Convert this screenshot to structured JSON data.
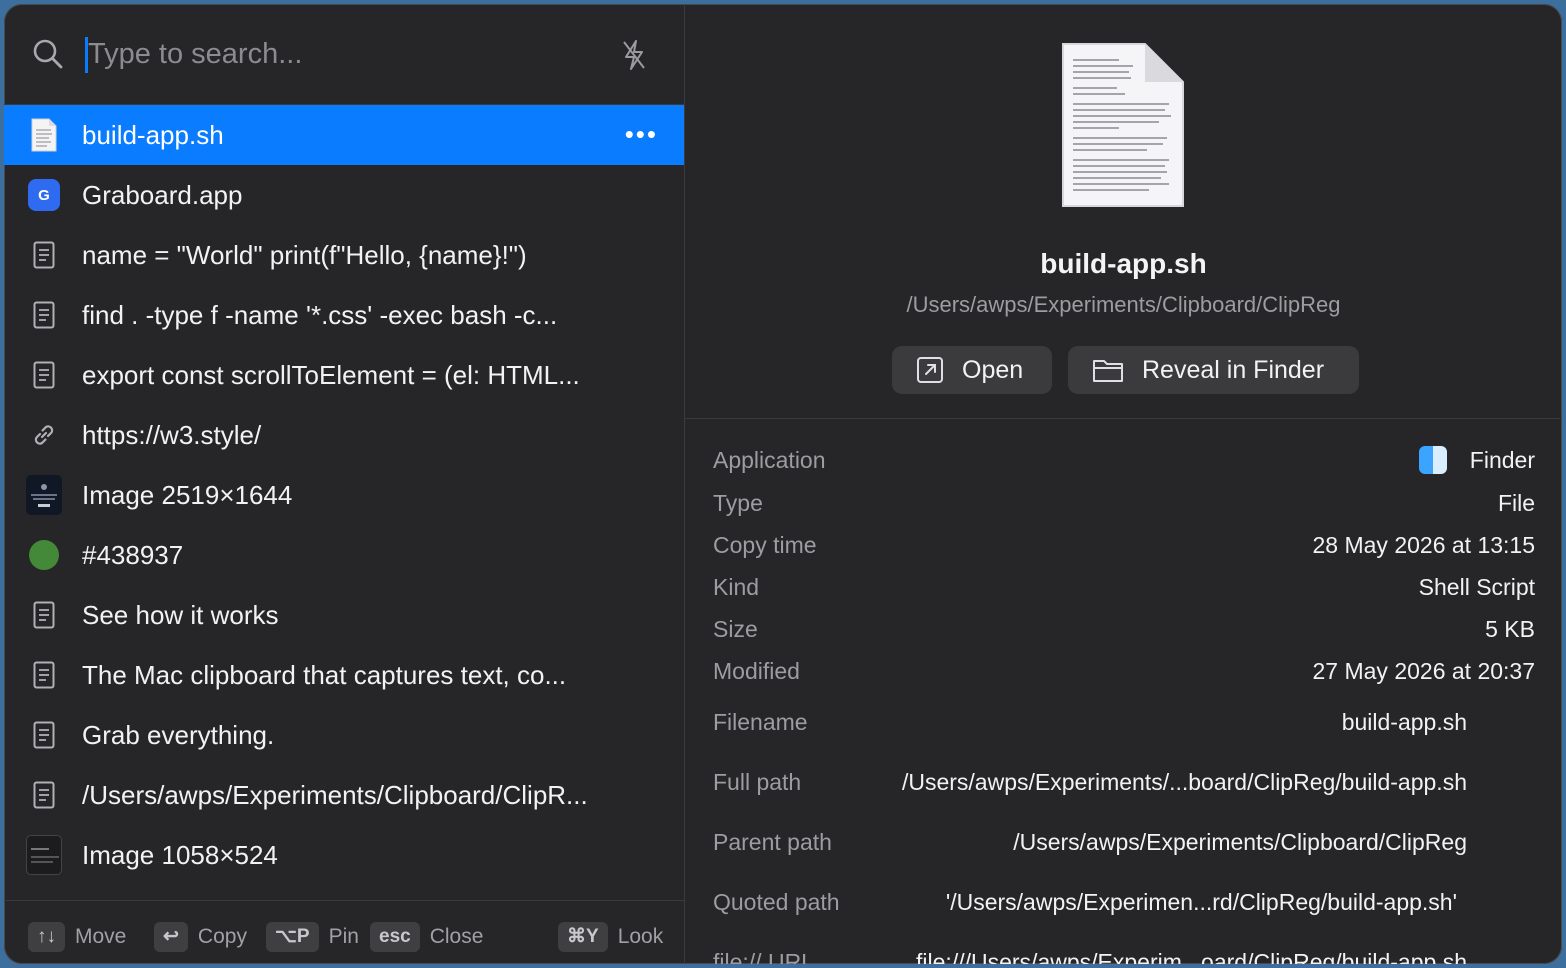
{
  "search": {
    "placeholder": "Type to search..."
  },
  "items": [
    {
      "label": "build-app.sh",
      "kind": "file",
      "more": "•••"
    },
    {
      "label": "Graboard.app",
      "kind": "app",
      "badge": "G"
    },
    {
      "label": "name = \"World\" print(f\"Hello, {name}!\")",
      "kind": "text"
    },
    {
      "label": "find . -type f -name '*.css' -exec bash -c...",
      "kind": "text"
    },
    {
      "label": "export const scrollToElement = (el: HTML...",
      "kind": "text"
    },
    {
      "label": "https://w3.style/",
      "kind": "link"
    },
    {
      "label": "Image 2519×1644",
      "kind": "image"
    },
    {
      "label": "#438937",
      "kind": "color",
      "color": "#438937"
    },
    {
      "label": "See how it works",
      "kind": "text"
    },
    {
      "label": "The Mac clipboard that captures text, co...",
      "kind": "text"
    },
    {
      "label": "Grab everything.",
      "kind": "text"
    },
    {
      "label": "/Users/awps/Experiments/Clipboard/ClipR...",
      "kind": "text"
    },
    {
      "label": "Image 1058×524",
      "kind": "image"
    }
  ],
  "footer": {
    "move": {
      "key": "↑↓",
      "label": "Move"
    },
    "copy": {
      "key": "↩",
      "label": "Copy"
    },
    "pin": {
      "key": "⌥P",
      "label": "Pin"
    },
    "close": {
      "key": "esc",
      "label": "Close"
    },
    "look": {
      "key": "⌘Y",
      "label": "Look"
    }
  },
  "preview": {
    "title": "build-app.sh",
    "path": "/Users/awps/Experiments/Clipboard/ClipReg",
    "open_label": "Open",
    "reveal_label": "Reveal in Finder"
  },
  "details": {
    "application": {
      "label": "Application",
      "value": "Finder"
    },
    "type": {
      "label": "Type",
      "value": "File"
    },
    "copy_time": {
      "label": "Copy time",
      "value": "28 May 2026 at 13:15"
    },
    "kind": {
      "label": "Kind",
      "value": "Shell Script"
    },
    "size": {
      "label": "Size",
      "value": "5 KB"
    },
    "modified": {
      "label": "Modified",
      "value": "27 May 2026 at 20:37"
    },
    "filename": {
      "label": "Filename",
      "value": "build-app.sh"
    },
    "full_path": {
      "label": "Full path",
      "value": "/Users/awps/Experiments/...board/ClipReg/build-app.sh"
    },
    "parent_path": {
      "label": "Parent path",
      "value": "/Users/awps/Experiments/Clipboard/ClipReg"
    },
    "quoted_path": {
      "label": "Quoted path",
      "value": "'/Users/awps/Experimen...rd/ClipReg/build-app.sh'"
    },
    "file_url": {
      "label": "file:// URL",
      "value": "file:///Users/awps/Experim...oard/ClipReg/build-app.sh"
    }
  },
  "colors": {
    "accent": "#0a7cff",
    "background": "#262628"
  }
}
